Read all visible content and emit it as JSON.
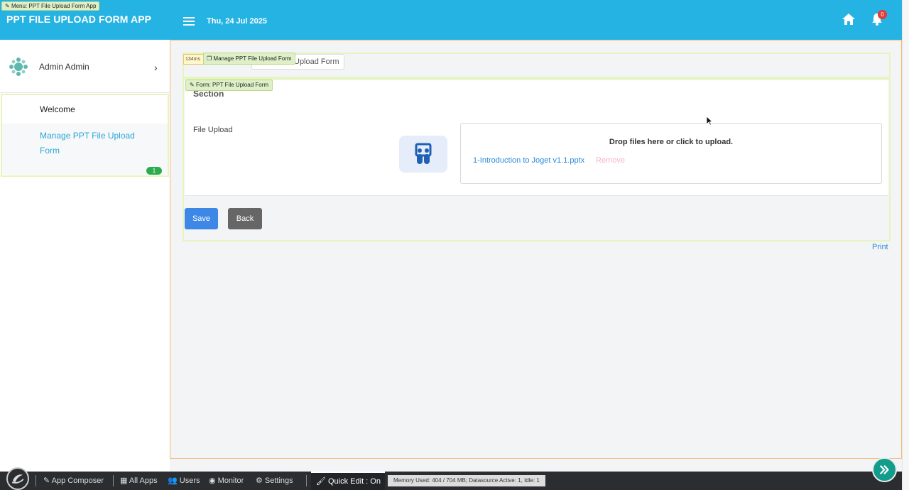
{
  "header": {
    "menu_tag": "Menu: PPT File Upload Form App",
    "app_title": "PPT FILE UPLOAD FORM APP",
    "date": "Thu, 24 Jul 2025",
    "notification_count": "0",
    "icons": [
      "hamburger-icon",
      "home-icon",
      "bell-icon"
    ]
  },
  "sidebar": {
    "user_name": "Admin Admin",
    "items": [
      {
        "label": "Welcome"
      },
      {
        "label": "Manage PPT File Upload Form",
        "count": "1",
        "active": true
      }
    ]
  },
  "breadcrumb": {
    "timing": "134ms",
    "tag": "Manage PPT File Upload Form",
    "tab_label": "Upload Form"
  },
  "form": {
    "tag": "Form: PPT File Upload Form",
    "section_title": "Section",
    "field_label": "File Upload",
    "dropzone_text": "Drop files here or click to upload.",
    "file_name": "1-Introduction to Joget v1.1.pptx",
    "remove_label": "Remove",
    "save_label": "Save",
    "back_label": "Back",
    "print_label": "Print"
  },
  "bottombar": {
    "app_composer": "App Composer",
    "all_apps": "All Apps",
    "users": "Users",
    "monitor": "Monitor",
    "settings": "Settings",
    "quick_edit": "Quick Edit : On",
    "memory": "Memory Used: 404 / 704 MB; Datasource Active: 1, Idle: 1"
  },
  "colors": {
    "header": "#25b3e3",
    "link": "#2b8ad8",
    "save": "#3d87e6",
    "back": "#666666",
    "fab": "#139c8b"
  }
}
